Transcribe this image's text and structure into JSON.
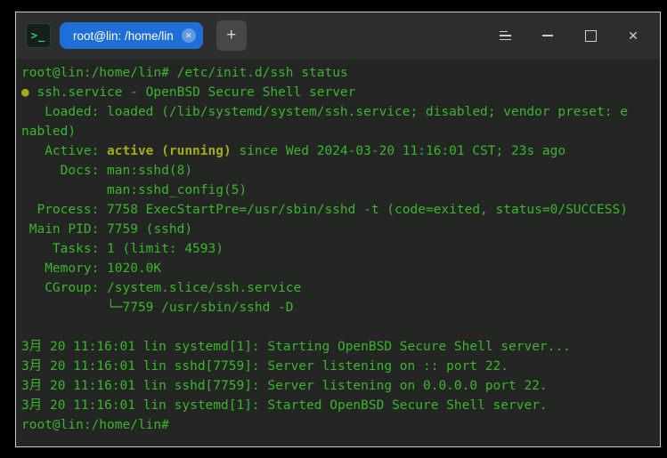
{
  "colors": {
    "green": "#3cb42d",
    "accent": "#a6aa1d",
    "tab_blue": "#1e6ed8",
    "titlebar_bg": "#2e2e2e",
    "terminal_bg": "#232623",
    "window_border": "#c9c9c9",
    "control_fg": "#cfcfcf",
    "app_icon_green": "#35d07f",
    "app_icon_bg": "#152019",
    "new_tab_bg": "#474747"
  },
  "title_bar": {
    "app_icon_glyph": ">_",
    "tab_title": "root@lin: /home/lin",
    "tab_close_glyph": "✕",
    "new_tab_glyph": "+",
    "close_glyph": "✕"
  },
  "terminal": {
    "lines": [
      {
        "segments": [
          {
            "text": "root@lin:/home/lin# /etc/init.d/ssh status",
            "style": "green"
          }
        ]
      },
      {
        "segments": [
          {
            "text": "● ",
            "style": "accent"
          },
          {
            "text": "ssh.service - OpenBSD Secure Shell server",
            "style": "green"
          }
        ]
      },
      {
        "segments": [
          {
            "text": "   Loaded: loaded (/lib/systemd/system/ssh.service; disabled; vendor preset: e",
            "style": "green"
          }
        ]
      },
      {
        "segments": [
          {
            "text": "nabled)",
            "style": "green"
          }
        ]
      },
      {
        "segments": [
          {
            "text": "   Active: ",
            "style": "green"
          },
          {
            "text": "active (running)",
            "style": "accent_bold"
          },
          {
            "text": " since Wed 2024-03-20 11:16:01 CST; 23s ago",
            "style": "green"
          }
        ]
      },
      {
        "segments": [
          {
            "text": "     Docs: man:sshd(8)",
            "style": "green"
          }
        ]
      },
      {
        "segments": [
          {
            "text": "           man:sshd_config(5)",
            "style": "green"
          }
        ]
      },
      {
        "segments": [
          {
            "text": "  Process: 7758 ExecStartPre=/usr/sbin/sshd -t (code=exited, status=0/SUCCESS)",
            "style": "green"
          }
        ]
      },
      {
        "segments": [
          {
            "text": " Main PID: 7759 (sshd)",
            "style": "green"
          }
        ]
      },
      {
        "segments": [
          {
            "text": "    Tasks: 1 (limit: 4593)",
            "style": "green"
          }
        ]
      },
      {
        "segments": [
          {
            "text": "   Memory: 1020.0K",
            "style": "green"
          }
        ]
      },
      {
        "segments": [
          {
            "text": "   CGroup: /system.slice/ssh.service",
            "style": "green"
          }
        ]
      },
      {
        "segments": [
          {
            "text": "           └─7759 /usr/sbin/sshd -D",
            "style": "green"
          }
        ]
      },
      {
        "segments": []
      },
      {
        "segments": [
          {
            "text": "3月 20 11:16:01 lin systemd[1]: Starting OpenBSD Secure Shell server...",
            "style": "green"
          }
        ]
      },
      {
        "segments": [
          {
            "text": "3月 20 11:16:01 lin sshd[7759]: Server listening on :: port 22.",
            "style": "green"
          }
        ]
      },
      {
        "segments": [
          {
            "text": "3月 20 11:16:01 lin sshd[7759]: Server listening on 0.0.0.0 port 22.",
            "style": "green"
          }
        ]
      },
      {
        "segments": [
          {
            "text": "3月 20 11:16:01 lin systemd[1]: Started OpenBSD Secure Shell server.",
            "style": "green"
          }
        ]
      },
      {
        "segments": [
          {
            "text": "root@lin:/home/lin# ",
            "style": "green"
          }
        ]
      }
    ]
  }
}
